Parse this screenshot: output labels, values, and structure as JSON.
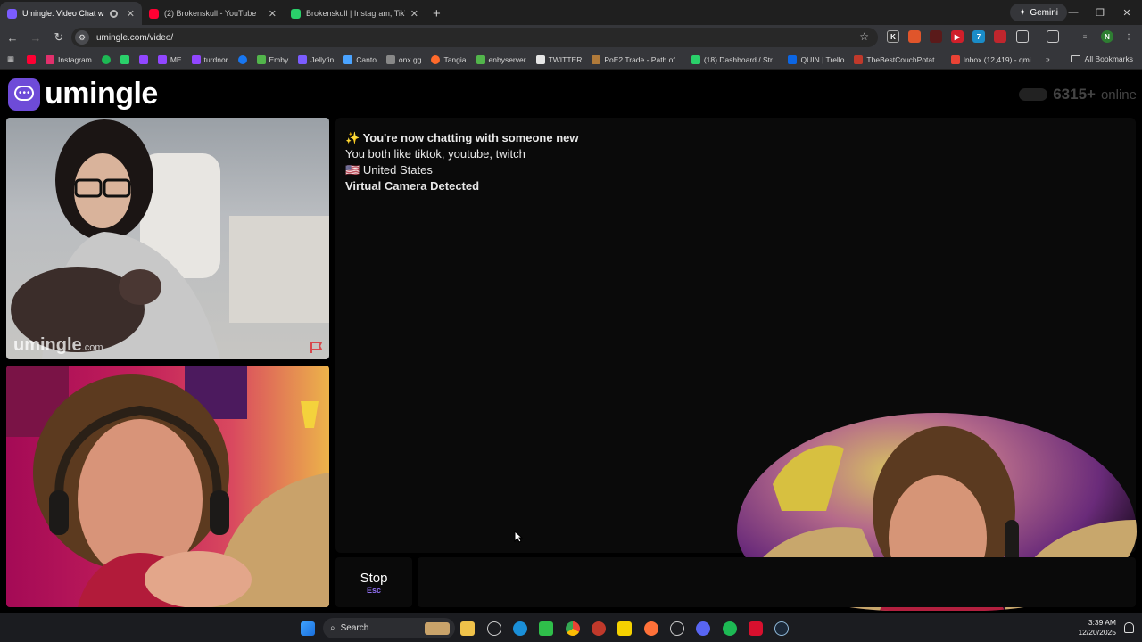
{
  "browser": {
    "tabs": [
      {
        "title": "Umingle: Video Chat with S",
        "active": true,
        "recording": true,
        "favicon_color": "#7b5cff"
      },
      {
        "title": "(2) Brokenskull - YouTube",
        "active": false,
        "favicon_color": "#ff0033"
      },
      {
        "title": "Brokenskull | Instagram, TikTok",
        "active": false,
        "favicon_color": "#2ad06a"
      }
    ],
    "new_tab": "+",
    "gemini_label": "Gemini",
    "url": "umingle.com/video/",
    "profile_initial": "N",
    "bookmarks": [
      {
        "label": "",
        "color": "#ff0033",
        "icon": "youtube-icon"
      },
      {
        "label": "Instagram",
        "color": "#e1306c",
        "icon": "instagram-icon"
      },
      {
        "label": "",
        "color": "#1db954",
        "icon": "spotify-icon"
      },
      {
        "label": "",
        "color": "#2ad06a",
        "icon": "bookmark-icon"
      },
      {
        "label": "",
        "color": "#9146ff",
        "icon": "twitch-icon"
      },
      {
        "label": "ME",
        "color": "#9146ff",
        "icon": "twitch-icon"
      },
      {
        "label": "turdnor",
        "color": "#9146ff",
        "icon": "twitch-icon"
      },
      {
        "label": "",
        "color": "#1877f2",
        "icon": "facebook-icon"
      },
      {
        "label": "Emby",
        "color": "#52b54b",
        "icon": "emby-icon"
      },
      {
        "label": "Jellyfin",
        "color": "#7b5cff",
        "icon": "jellyfin-icon"
      },
      {
        "label": "Canto",
        "color": "#4aa3ff",
        "icon": "canto-icon"
      },
      {
        "label": "onx.gg",
        "color": "#888888",
        "icon": "onx-icon"
      },
      {
        "label": "Tangia",
        "color": "#ff6a2b",
        "icon": "tangia-icon"
      },
      {
        "label": "enbyserver",
        "color": "#52b54b",
        "icon": "emby-icon"
      },
      {
        "label": "TWITTER",
        "color": "#e6e6e6",
        "icon": "x-icon"
      },
      {
        "label": "PoE2 Trade - Path of...",
        "color": "#b07a3a",
        "icon": "poe-icon"
      },
      {
        "label": "(18) Dashboard / Str...",
        "color": "#2ad06a",
        "icon": "dashboard-icon"
      },
      {
        "label": "QUIN | Trello",
        "color": "#0c66e4",
        "icon": "trello-icon"
      },
      {
        "label": "TheBestCouchPotat...",
        "color": "#c0392b",
        "icon": "couch-icon"
      },
      {
        "label": "Inbox (12,419) - qmi...",
        "color": "#ea4335",
        "icon": "gmail-icon"
      }
    ],
    "all_bookmarks": "All Bookmarks"
  },
  "site": {
    "logo_text": "umingle",
    "online_count": "6315+",
    "online_label": "online",
    "watermark": "umingle",
    "watermark_suffix": ".com"
  },
  "chat": {
    "lines": [
      {
        "prefix": "✨",
        "text": "You're now chatting with someone new",
        "bold": true
      },
      {
        "prefix": "",
        "text": "You both like tiktok, youtube, twitch",
        "bold": false
      },
      {
        "prefix": "🇺🇸",
        "text": "United States",
        "bold": false
      },
      {
        "prefix": "",
        "text": "Virtual Camera Detected",
        "bold": true
      }
    ],
    "stop_label": "Stop",
    "stop_key": "Esc",
    "input_value": "",
    "input_placeholder": ""
  },
  "taskbar": {
    "search_label": "Search",
    "time": "3:39 AM",
    "date": "12/20/2025"
  }
}
